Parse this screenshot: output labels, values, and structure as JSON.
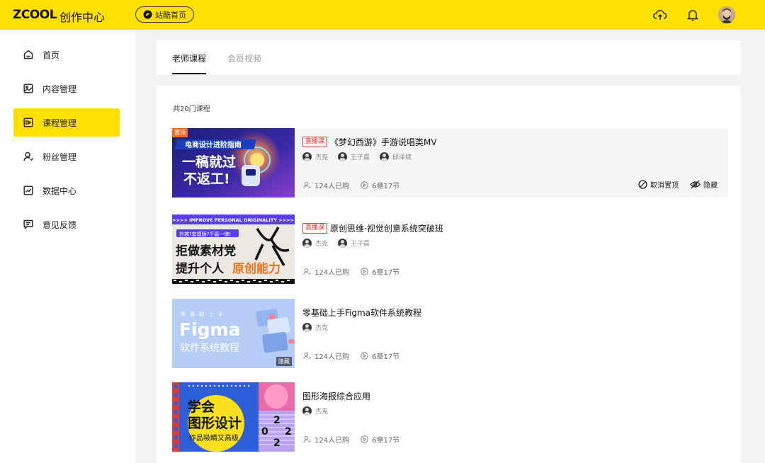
{
  "header": {
    "logo": "ZCOOL",
    "logo_sub": "创作中心",
    "home_link": "站酷首页",
    "icons": [
      "upload-icon",
      "bell-icon",
      "avatar"
    ],
    "accent": "#ffe000"
  },
  "sidebar": {
    "items": [
      {
        "label": "首页",
        "icon": "home-icon"
      },
      {
        "label": "内容管理",
        "icon": "image-icon"
      },
      {
        "label": "课程管理",
        "icon": "course-icon",
        "active": true
      },
      {
        "label": "粉丝管理",
        "icon": "user-icon"
      },
      {
        "label": "数据中心",
        "icon": "chart-icon"
      },
      {
        "label": "意见反馈",
        "icon": "feedback-icon"
      }
    ]
  },
  "tabs": [
    {
      "label": "老师课程",
      "active": true
    },
    {
      "label": "会员视频",
      "active": false
    }
  ],
  "list": {
    "total": "共20门课程",
    "courses": [
      {
        "tag": "直播课",
        "title": "《梦幻西游》手游说唱类MV",
        "teachers": [
          "杰克",
          "王子晨",
          "邱泽斌"
        ],
        "buyers": "124人已购",
        "chapters": "6章17节",
        "thumb_badge": "置顶",
        "thumb_text": [
          "电商设计进阶指南",
          "一稿就过",
          "不返工!"
        ],
        "actions": [
          "取消置顶",
          "隐藏"
        ]
      },
      {
        "tag": "直播课",
        "title": "原创思维·视觉创意系统突破班",
        "teachers": [
          "杰克",
          "王子晨"
        ],
        "buyers": "124人已购",
        "chapters": "6章17节",
        "thumb_text": [
          ">>>> IMPROVE PERSONAL ORIGINALITY >>>>",
          "抄袭?套模版?千篇一律!",
          "拒做素材党",
          "提升个人",
          "原创能力"
        ]
      },
      {
        "tag": "",
        "title": "零基础上手Figma软件系统教程",
        "teachers": [
          "杰克"
        ],
        "buyers": "124人已购",
        "chapters": "6章17节",
        "thumb_badge_hide": "隐藏",
        "thumb_text": [
          "零 基 础 上 手",
          "Figma",
          "软件系统教程"
        ]
      },
      {
        "tag": "",
        "title": "图形海报综合应用",
        "teachers": [
          "杰克"
        ],
        "buyers": "124人已购",
        "chapters": "6章17节",
        "thumb_text": [
          "学会",
          "图形设计",
          "作品吸睛又高级",
          "2",
          "0",
          "2",
          "2"
        ]
      }
    ]
  }
}
